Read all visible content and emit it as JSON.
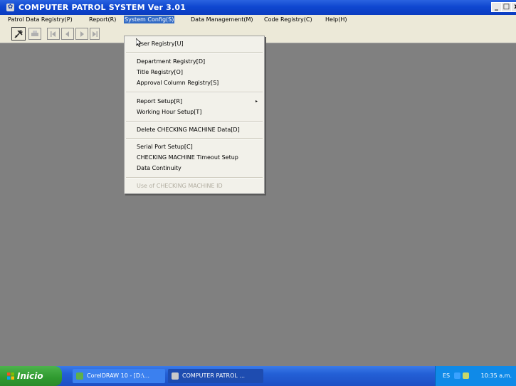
{
  "window": {
    "title": "COMPUTER PATROL SYSTEM  Ver 3.01",
    "icon": "app-icon",
    "minimize": "_",
    "restore": "□",
    "close": "x"
  },
  "menubar": {
    "items": [
      "Patrol Data Registry(P)",
      "Report(R)",
      "System Config(S)",
      "Data Management(M)",
      "Code Registry(C)",
      "Help(H)"
    ],
    "active_index": 2
  },
  "toolbar": {
    "buttons": [
      "tool-icon",
      "print-icon",
      "first-record-icon",
      "prev-record-icon",
      "next-record-icon",
      "last-record-icon"
    ]
  },
  "dropdown": {
    "items": {
      "user_registry": "User Registry[U]",
      "department_registry": "Department Registry[D]",
      "title_registry": "Title Registry[O]",
      "approval_column_registry": "Approval Column Registry[S]",
      "report_setup": "Report Setup[R]",
      "working_hour_setup": "Working Hour Setup[T]",
      "delete_data": "Delete CHECKING MACHINE Data[D]",
      "serial_port_setup": "Serial Port Setup[C]",
      "timeout_setup": "CHECKING MACHINE Timeout Setup",
      "data_continuity": "Data Continuity",
      "use_machine_id": "Use of CHECKING MACHINE ID"
    },
    "submenu_arrow": "▸"
  },
  "taskbar": {
    "start_label": "Inicio",
    "tasks": [
      "CorelDRAW 10 - [D:\\...",
      "COMPUTER PATROL ..."
    ],
    "tray_lang": "ES",
    "clock": "10:35 a.m."
  },
  "colors": {
    "title_bar": "#0f47d0",
    "menu_highlight": "#316ac5",
    "workspace": "#808080",
    "start_button": "#2f9a2f"
  }
}
